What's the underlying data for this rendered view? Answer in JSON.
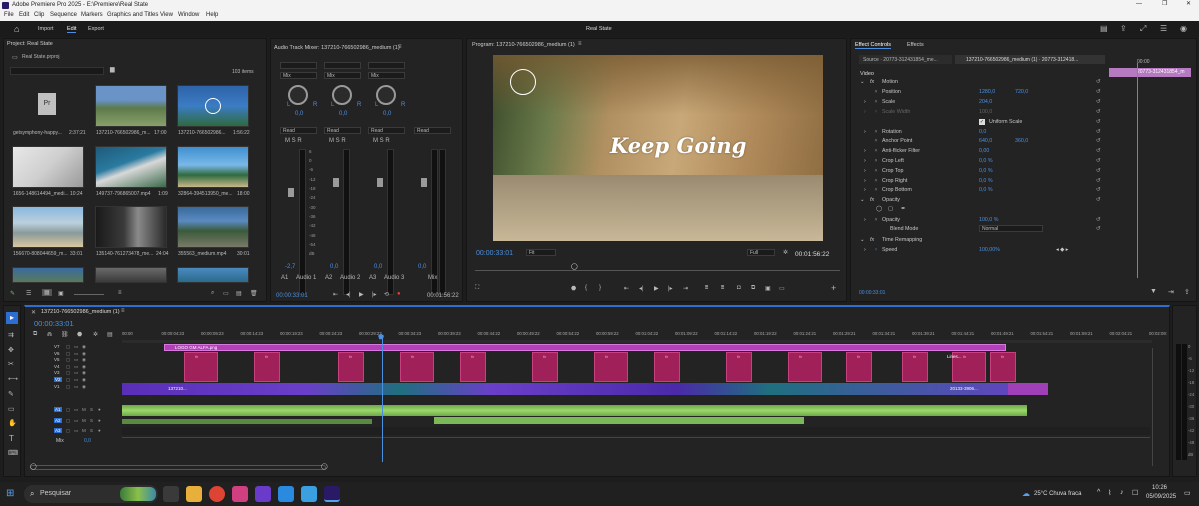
{
  "window": {
    "title": "Adobe Premiere Pro 2025 - E:\\Premiere\\Real State",
    "project_name": "Real State"
  },
  "menu": [
    "File",
    "Edit",
    "Clip",
    "Sequence",
    "Markers",
    "Graphics and Titles",
    "View",
    "Window",
    "Help"
  ],
  "workspace_tabs": [
    "Import",
    "Edit",
    "Export"
  ],
  "active_workspace": "Edit",
  "project": {
    "title": "Project: Real State",
    "file": "Real State.prproj",
    "count": "103 items",
    "items": [
      {
        "name": "getsymphony-happy...",
        "dur": "2:37:21"
      },
      {
        "name": "137210-766502986_m...",
        "dur": "17:00"
      },
      {
        "name": "137210-766502986...",
        "dur": "1:56:22"
      },
      {
        "name": "1656-148614494_medi...",
        "dur": "10:24"
      },
      {
        "name": "149737-796865007.mp4",
        "dur": "1:09"
      },
      {
        "name": "32864-394513950_me...",
        "dur": "18:00"
      },
      {
        "name": "156670-808044659_m...",
        "dur": "33:01"
      },
      {
        "name": "135140-761273478_me...",
        "dur": "24:04"
      },
      {
        "name": "355563_medium.mp4",
        "dur": "30:01"
      }
    ]
  },
  "mixer": {
    "title": "Audio Track Mixer: 137210-766502986_medium (1)",
    "channels": [
      {
        "mode": "Mix",
        "value": "0,0",
        "auto": "Read",
        "label": "A1",
        "name": "Audio 1",
        "db": "-2,7"
      },
      {
        "mode": "Mix",
        "value": "0,0",
        "auto": "Read",
        "label": "A2",
        "name": "Audio 2",
        "db": "0,0"
      },
      {
        "mode": "Mix",
        "value": "0,0",
        "auto": "Read",
        "label": "A3",
        "name": "Audio 3",
        "db": "0,0"
      },
      {
        "mode": "",
        "value": "",
        "auto": "Read",
        "label": "",
        "name": "Mix",
        "db": "0,0"
      }
    ],
    "scale": [
      "6",
      "0",
      "-6",
      "-12",
      "-18",
      "-24",
      "-30",
      "-36",
      "-42",
      "-48",
      "-54",
      "dB"
    ],
    "time_left": "00:00:33:01",
    "time_right": "00:01:56:22"
  },
  "program": {
    "title": "Program: 137210-766502986_medium (1)",
    "overlay_text": "Keep Going",
    "timecode": "00:00:33:01",
    "fit": "Fit",
    "quality": "Full",
    "duration": "00:01:56:22"
  },
  "effects": {
    "tabs": [
      "Effect Controls",
      "Effects"
    ],
    "source": "Source · 20773-312431854_me...",
    "clip": "137210-766502986_medium (1) · 20773-312418...",
    "mini_clip": "20773-312431854_m",
    "mini_time": "00:00",
    "section": "Video",
    "motion": "Motion",
    "rows": [
      {
        "name": "Position",
        "v1": "1280,0",
        "v2": "720,0"
      },
      {
        "name": "Scale",
        "v1": "204,0",
        "v2": ""
      },
      {
        "name": "Scale Width",
        "v1": "100,0",
        "v2": ""
      },
      {
        "name": "Uniform Scale",
        "v1": "",
        "v2": ""
      },
      {
        "name": "Rotation",
        "v1": "0,0",
        "v2": ""
      },
      {
        "name": "Anchor Point",
        "v1": "640,0",
        "v2": "360,0"
      },
      {
        "name": "Anti-flicker Filter",
        "v1": "0,00",
        "v2": ""
      },
      {
        "name": "Crop Left",
        "v1": "0,0 %",
        "v2": ""
      },
      {
        "name": "Crop Top",
        "v1": "0,0 %",
        "v2": ""
      },
      {
        "name": "Crop Right",
        "v1": "0,0 %",
        "v2": ""
      },
      {
        "name": "Crop Bottom",
        "v1": "0,0 %",
        "v2": ""
      }
    ],
    "opacity_section": "Opacity",
    "opacity": "100,0 %",
    "blend_label": "Blend Mode",
    "blend": "Normal",
    "time_remap": "Time Remapping",
    "speed_label": "Speed",
    "speed": "100,00%",
    "footer_time": "00:00:33:01"
  },
  "timeline": {
    "tab": "137210-766502986_medium (1)",
    "timecode": "00:00:33:01",
    "ruler": [
      "00:00",
      "00:00:04:23",
      "00:00:09:23",
      "00:00:14:23",
      "00:00:19:23",
      "00:00:24:23",
      "00:00:29:23",
      "00:00:34:23",
      "00:00:39:23",
      "00:00:44:22",
      "00:00:49:22",
      "00:00:54:22",
      "00:00:59:22",
      "00:01:04:22",
      "00:01:09:22",
      "00:01:14:22",
      "00:01:19:22",
      "00:01:24:21",
      "00:01:29:21",
      "00:01:34:21",
      "00:01:39:21",
      "00:01:44:21",
      "00:01:49:21",
      "00:01:54:21",
      "00:01:59:21",
      "00:02:04:21",
      "00:02:09:"
    ],
    "video_tracks": [
      "V7",
      "V6",
      "V5",
      "V4",
      "V3",
      "V2",
      "V1"
    ],
    "audio_tracks": [
      "A1",
      "A2",
      "A3"
    ],
    "mix_label": "Mix",
    "mix_value": "0,0",
    "logo_clip": "LOGO GM ALFA.png",
    "v1_clip": "137210...",
    "v1_clip_end": "20133-3906...",
    "lines_label": "Lines...",
    "fx": "fx",
    "meter_scale": [
      "0",
      "-6",
      "-12",
      "-18",
      "-24",
      "-30",
      "-36",
      "-42",
      "-48",
      "dB"
    ]
  },
  "taskbar": {
    "search": "Pesquisar",
    "weather": "25°C  Chuva fraca",
    "time": "10:26",
    "date": "05/09/2025"
  }
}
